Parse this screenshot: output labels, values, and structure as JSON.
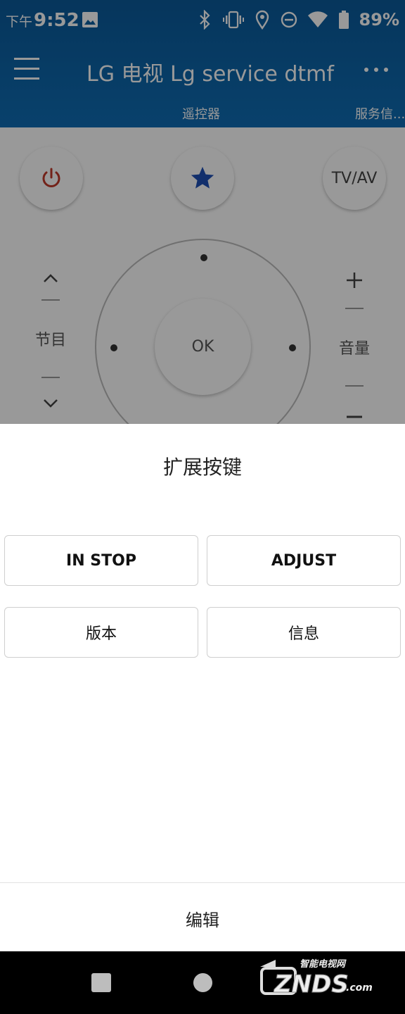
{
  "status_bar": {
    "time_prefix": "下午",
    "time": "9:52",
    "battery": "89%",
    "icons": [
      "image-icon",
      "bluetooth-icon",
      "vibrate-icon",
      "location-icon",
      "dnd-icon",
      "wifi-icon",
      "battery-icon"
    ]
  },
  "app_bar": {
    "title": "LG 电视 Lg service dtmf",
    "tabs": [
      {
        "label": "遥控器",
        "active": true
      },
      {
        "label": "服务信...",
        "active": false
      }
    ]
  },
  "remote": {
    "tvav_label": "TV/AV",
    "channel_label": "节目",
    "volume_label": "音量",
    "ok_label": "OK",
    "power_color": "#c0392b",
    "star_color": "#1f4fb5"
  },
  "sheet": {
    "title": "扩展按键",
    "buttons": [
      "IN STOP",
      "ADJUST",
      "版本",
      "信息"
    ],
    "edit_label": "编辑"
  },
  "watermark": {
    "text_cn": "智能电视网",
    "text_en": "ZNDS",
    "suffix": ".com"
  },
  "colors": {
    "app_bar": "#0f6db4",
    "scrim": "rgba(0,0,0,0.4)"
  }
}
